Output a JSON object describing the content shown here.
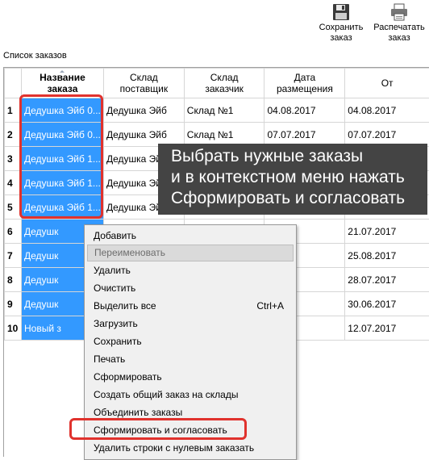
{
  "toolbar": {
    "save_label": "Сохранить\nзаказ",
    "print_label": "Распечатать\nзаказ"
  },
  "orders_label": "Список заказов",
  "table": {
    "headers": [
      "Название\nзаказа",
      "Склад\nпоставщик",
      "Склад\nзаказчик",
      "Дата\nразмещения",
      "От"
    ],
    "rows": [
      {
        "num": "1",
        "name": "Дедушка Эйб 0...",
        "supplier": "Дедушка Эйб",
        "customer": "Склад №1",
        "placed": "04.08.2017",
        "from": "04.08.2017"
      },
      {
        "num": "2",
        "name": "Дедушка Эйб 0...",
        "supplier": "Дедушка Эйб",
        "customer": "Склад №1",
        "placed": "07.07.2017",
        "from": "07.07.2017"
      },
      {
        "num": "3",
        "name": "Дедушка Эйб 1...",
        "supplier": "Дедушка Эйб",
        "customer": "",
        "placed": "",
        "from": ""
      },
      {
        "num": "4",
        "name": "Дедушка Эйб 1...",
        "supplier": "Дедушка Эйб",
        "customer": "",
        "placed": "",
        "from": ""
      },
      {
        "num": "5",
        "name": "Дедушка Эйб 1...",
        "supplier": "Дедушка Эйб",
        "customer": "",
        "placed": "",
        "from": ""
      },
      {
        "num": "6",
        "name": "Дедушк",
        "supplier": "",
        "customer": "",
        "placed": "17",
        "from": "21.07.2017"
      },
      {
        "num": "7",
        "name": "Дедушк",
        "supplier": "",
        "customer": "",
        "placed": "17",
        "from": "25.08.2017"
      },
      {
        "num": "8",
        "name": "Дедушк",
        "supplier": "",
        "customer": "",
        "placed": "17",
        "from": "28.07.2017"
      },
      {
        "num": "9",
        "name": "Дедушк",
        "supplier": "",
        "customer": "",
        "placed": "17",
        "from": "30.06.2017"
      },
      {
        "num": "10",
        "name": "Новый з",
        "supplier": "",
        "customer": "",
        "placed": "",
        "from": "12.07.2017"
      }
    ]
  },
  "callout": {
    "lines": [
      "Выбрать нужные заказы",
      "и в контекстном меню нажать",
      "Сформировать и согласовать"
    ]
  },
  "context_menu": {
    "items": [
      {
        "label": "Добавить",
        "shortcut": ""
      },
      {
        "label": "Переименовать",
        "shortcut": "",
        "disabled": true
      },
      {
        "label": "Удалить",
        "shortcut": ""
      },
      {
        "label": "Очистить",
        "shortcut": ""
      },
      {
        "label": "Выделить все",
        "shortcut": "Ctrl+A"
      },
      {
        "label": "Загрузить",
        "shortcut": ""
      },
      {
        "label": "Сохранить",
        "shortcut": ""
      },
      {
        "label": "Печать",
        "shortcut": ""
      },
      {
        "label": "Сформировать",
        "shortcut": ""
      },
      {
        "label": "Создать общий заказ на склады",
        "shortcut": ""
      },
      {
        "label": "Объединить заказы",
        "shortcut": ""
      },
      {
        "label": "Сформировать и согласовать",
        "shortcut": ""
      },
      {
        "label": "Удалить строки с нулевым заказать",
        "shortcut": ""
      }
    ]
  },
  "colors": {
    "selection": "#3399ff",
    "highlight_border": "#e0322d",
    "callout_bg": "#444444",
    "menu_bg": "#f0f0f0"
  },
  "icons": {
    "save": "floppy-disk-icon",
    "print": "printer-icon"
  }
}
